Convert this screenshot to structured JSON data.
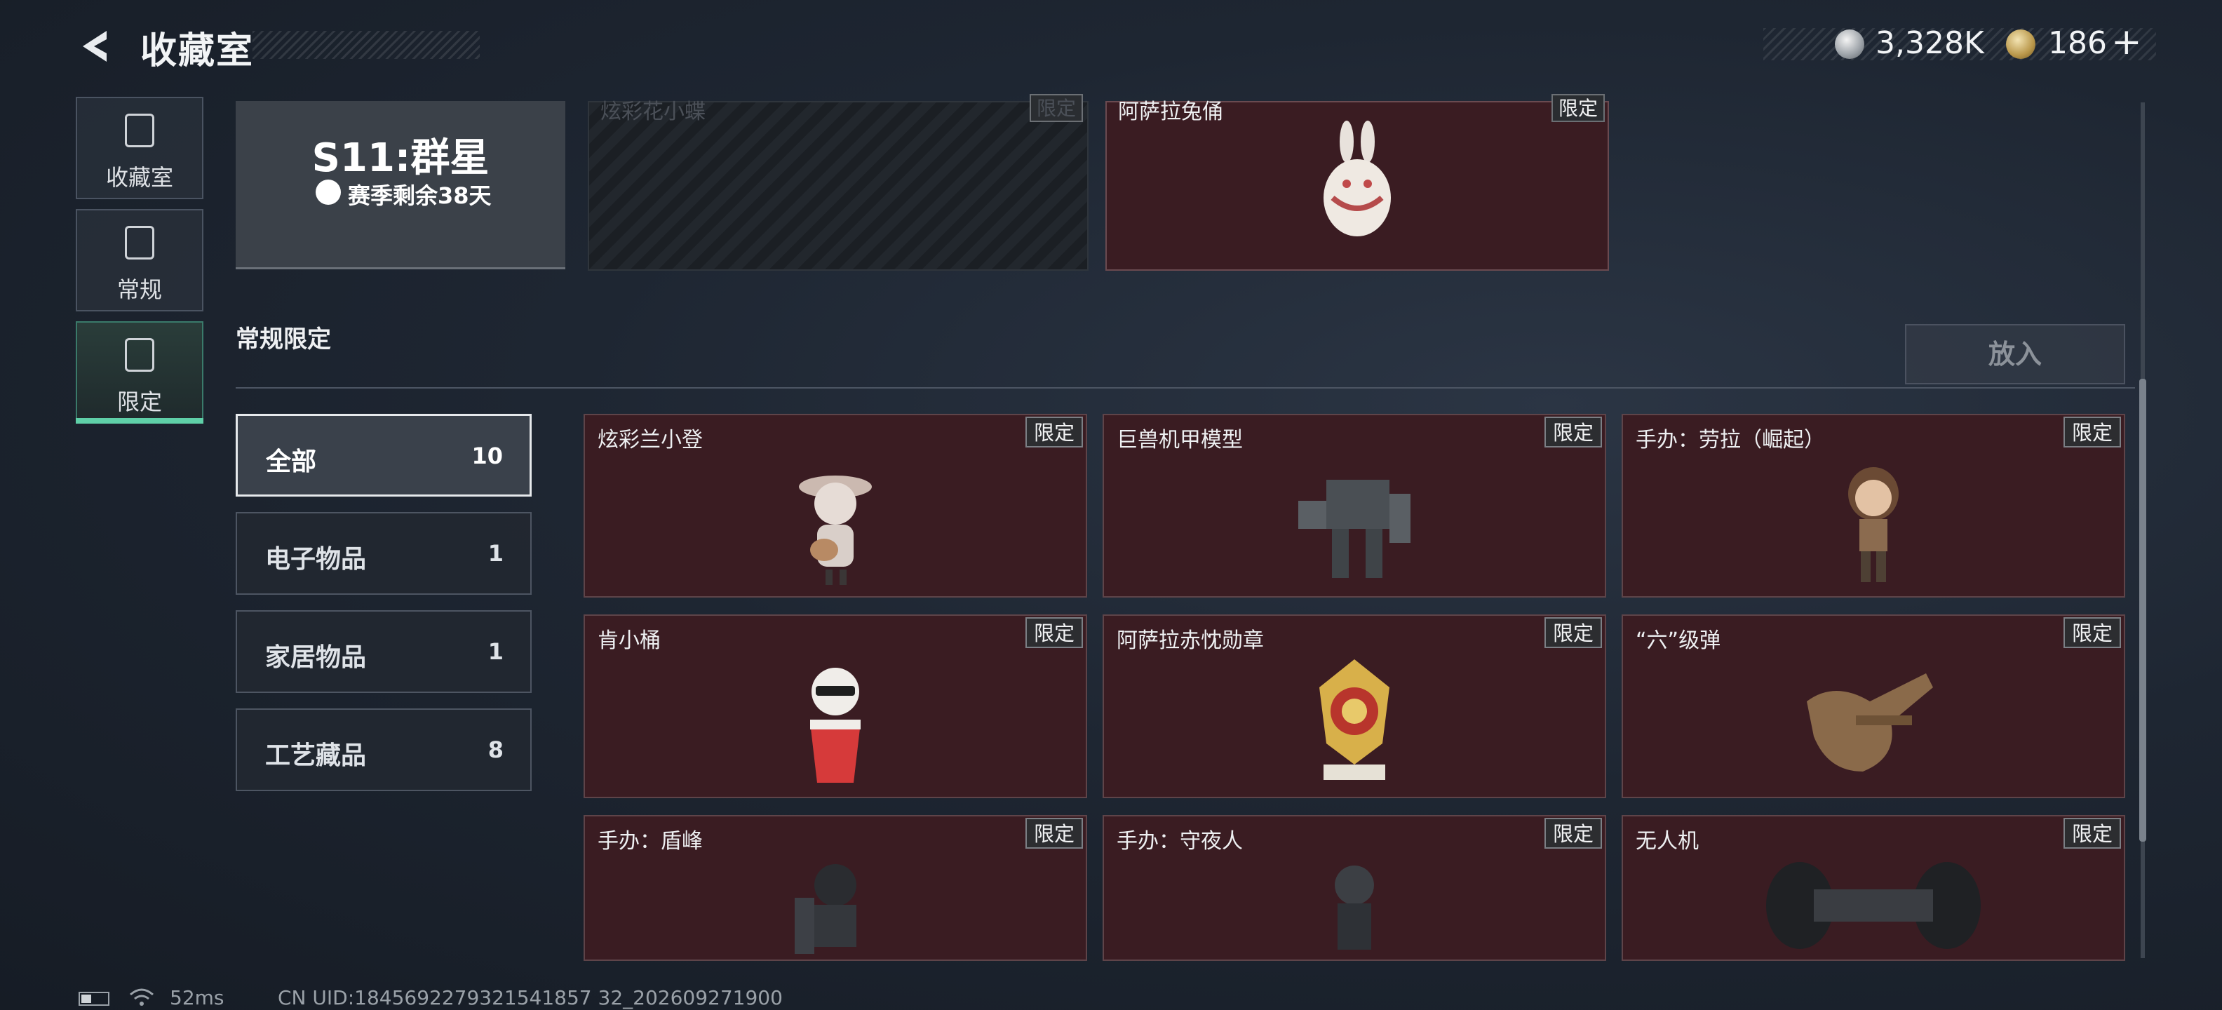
{
  "header": {
    "title": "收藏室",
    "currency_silver": "3,328K",
    "currency_gold": "186",
    "plus": "+"
  },
  "nav": {
    "items": [
      {
        "label": "收藏室"
      },
      {
        "label": "常规"
      },
      {
        "label": "限定"
      }
    ]
  },
  "season": {
    "name": "S11:群星",
    "remaining": "赛季剩余38天"
  },
  "top_row": [
    {
      "name": "炫彩花小蝶",
      "badge": "限定"
    },
    {
      "name": "阿萨拉兔俑",
      "badge": "限定"
    }
  ],
  "section": {
    "title": "常规限定",
    "put_button": "放入"
  },
  "categories": [
    {
      "name": "全部",
      "count": "10"
    },
    {
      "name": "电子物品",
      "count": "1"
    },
    {
      "name": "家居物品",
      "count": "1"
    },
    {
      "name": "工艺藏品",
      "count": "8"
    }
  ],
  "items": [
    {
      "name": "炫彩兰小登",
      "badge": "限定"
    },
    {
      "name": "巨兽机甲模型",
      "badge": "限定"
    },
    {
      "name": "手办：劳拉（崛起）",
      "badge": "限定"
    },
    {
      "name": "肯小桶",
      "badge": "限定"
    },
    {
      "name": "阿萨拉赤忱勋章",
      "badge": "限定"
    },
    {
      "name": "“六”级弹",
      "badge": "限定"
    },
    {
      "name": "手办：盾峰",
      "badge": "限定"
    },
    {
      "name": "手办：守夜人",
      "badge": "限定"
    },
    {
      "name": "无人机",
      "badge": "限定"
    }
  ],
  "footer": {
    "ping": "52ms",
    "uid": "CN UID:1845692279321541857 32_202609271900"
  },
  "colors": {
    "card_bg": "#3a1c22",
    "accent_green": "#5fd0a8"
  }
}
